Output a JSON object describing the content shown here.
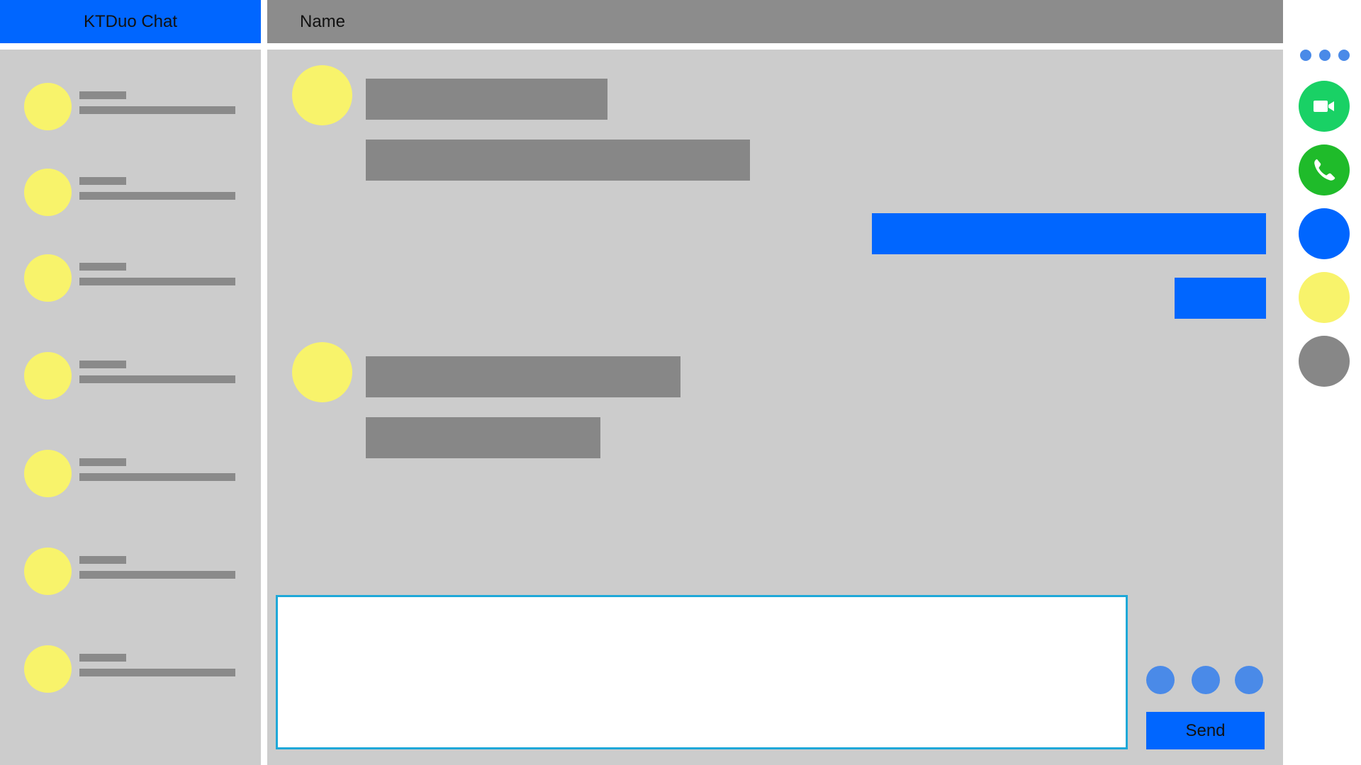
{
  "app": {
    "title": "KTDuo Chat"
  },
  "header": {
    "title": "Name"
  },
  "contacts": [
    {
      "avatar_color": "#f8f36b"
    },
    {
      "avatar_color": "#f8f36b"
    },
    {
      "avatar_color": "#f8f36b"
    },
    {
      "avatar_color": "#f8f36b"
    },
    {
      "avatar_color": "#f8f36b"
    },
    {
      "avatar_color": "#f8f36b"
    },
    {
      "avatar_color": "#f8f36b"
    }
  ],
  "composer": {
    "value": "",
    "placeholder": "",
    "send_label": "Send"
  },
  "right_rail": {
    "more_icon": "more-horizontal-icon",
    "buttons": [
      {
        "icon": "video-camera-icon",
        "color": "#19d165"
      },
      {
        "icon": "phone-icon",
        "color": "#1fbb2a"
      },
      {
        "icon": "circle-button",
        "color": "#0066ff"
      },
      {
        "icon": "circle-button",
        "color": "#f8f36b"
      },
      {
        "icon": "circle-button",
        "color": "#878787"
      }
    ]
  },
  "colors": {
    "accent": "#0066ff",
    "panel": "#cccccc",
    "header": "#8c8c8c",
    "avatar": "#f8f36b",
    "incoming_bubble": "#878787",
    "outgoing_bubble": "#0066ff"
  }
}
